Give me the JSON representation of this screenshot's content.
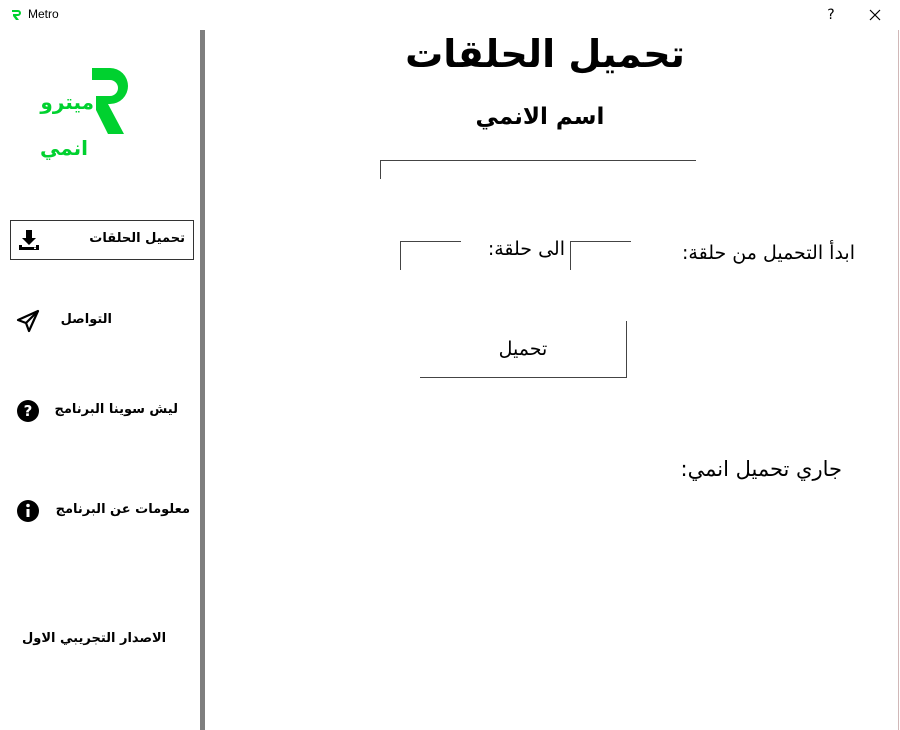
{
  "window": {
    "title": "Metro",
    "help_label": "?"
  },
  "logo": {
    "line1": "ميترو",
    "line2": "انمي",
    "color": "#00d12f"
  },
  "sidebar": {
    "items": [
      {
        "label": "تحميل الحلقات",
        "icon": "download-icon",
        "active": true
      },
      {
        "label": "التواصل",
        "icon": "send-icon",
        "active": false
      },
      {
        "label": "ليش سوينا البرنامج",
        "icon": "question-icon",
        "active": false
      },
      {
        "label": "معلومات عن البرنامج",
        "icon": "info-icon",
        "active": false
      }
    ],
    "version": "الاصدار التجريبي الاول"
  },
  "main": {
    "title": "تحميل الحلقات",
    "anime_name_label": "اسم الانمي",
    "anime_name_value": "",
    "from_label": "ابدأ التحميل من حلقة:",
    "to_label": "الى حلقة:",
    "from_value": "",
    "to_value": "",
    "download_button": "تحميل",
    "status_label": "جاري تحميل انمي:"
  }
}
